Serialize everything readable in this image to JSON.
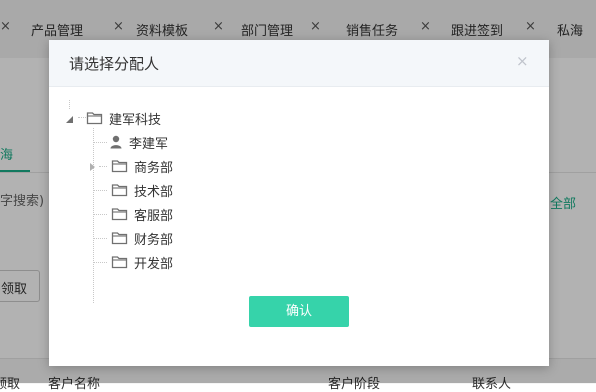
{
  "tabs": [
    {
      "label": "",
      "close": "×"
    },
    {
      "label": "产品管理",
      "close": "×"
    },
    {
      "label": "资料模板",
      "close": "×"
    },
    {
      "label": "部门管理",
      "close": "×"
    },
    {
      "label": "销售任务",
      "close": "×"
    },
    {
      "label": "跟进签到",
      "close": "×"
    },
    {
      "label": "私海",
      "close": ""
    }
  ],
  "background": {
    "left_tab": "海",
    "search_hint": "字搜索)",
    "link_all": "全部",
    "claim_button": "领取",
    "table_headers": [
      "领取",
      "客户名称",
      "客户阶段",
      "联系人"
    ]
  },
  "modal": {
    "title": "请选择分配人",
    "close": "×",
    "confirm": "确认"
  },
  "tree": {
    "root": {
      "label": "建军科技",
      "expanded": true
    },
    "children": [
      {
        "label": "李建军",
        "type": "user"
      },
      {
        "label": "商务部",
        "type": "folder",
        "has_children": true
      },
      {
        "label": "技术部",
        "type": "folder"
      },
      {
        "label": "客服部",
        "type": "folder"
      },
      {
        "label": "财务部",
        "type": "folder"
      },
      {
        "label": "开发部",
        "type": "folder"
      }
    ]
  },
  "colors": {
    "accent": "#36d3aa",
    "link": "#1aae88",
    "icon": "#707070"
  }
}
